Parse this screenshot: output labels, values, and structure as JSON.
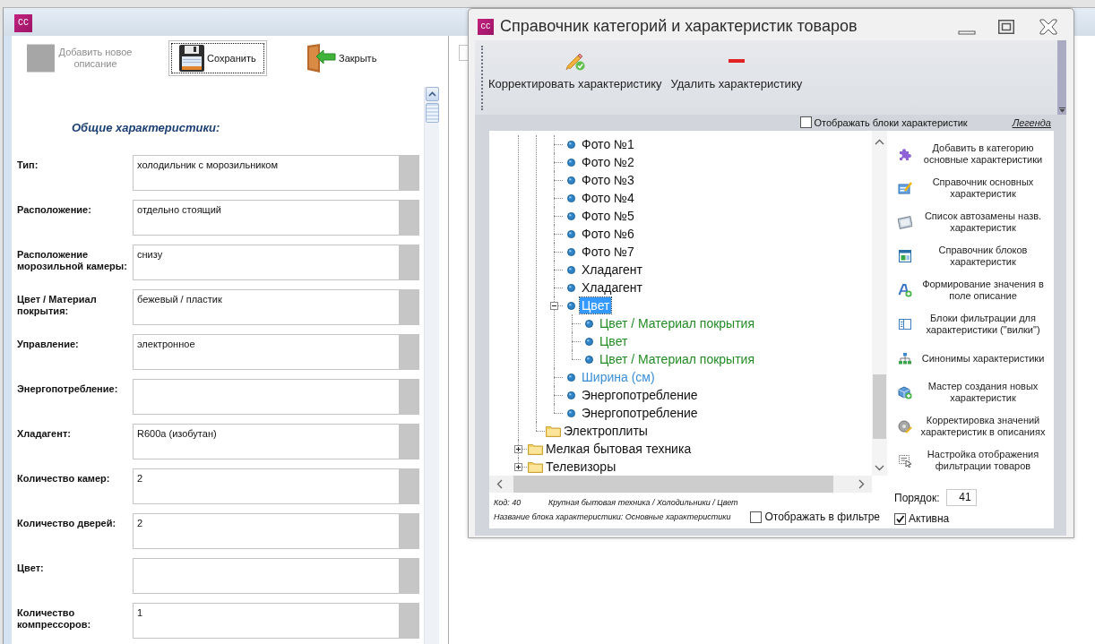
{
  "main_window": {
    "logo": "CC",
    "toolbar": [
      {
        "kind": "add",
        "label": "Добавить новое описание",
        "disabled": true,
        "focused": false
      },
      {
        "kind": "save",
        "label": "Сохранить",
        "disabled": false,
        "focused": true
      },
      {
        "kind": "close",
        "label": "Закрыть",
        "disabled": false,
        "focused": false
      }
    ],
    "section_title": "Общие характеристики:",
    "fields": [
      {
        "label": "Тип:",
        "value": "холодильник с морозильником"
      },
      {
        "label": "Расположение:",
        "value": "отдельно стоящий"
      },
      {
        "label": "Расположение морозильной камеры:",
        "value": "снизу"
      },
      {
        "label": "Цвет / Материал покрытия:",
        "value": "бежевый / пластик"
      },
      {
        "label": "Управление:",
        "value": "электронное"
      },
      {
        "label": "Энергопотребление:"
      },
      {
        "label": "Хладагент:",
        "value": "R600a (изобутан)"
      },
      {
        "label": "Количество камер:",
        "value": "2"
      },
      {
        "label": "Количество дверей:",
        "value": "2"
      },
      {
        "label": "Цвет:"
      },
      {
        "label": "Количество компрессоров:",
        "value": "1"
      }
    ]
  },
  "dialog": {
    "logo": "CC",
    "title": "Справочник категорий и характеристик товаров",
    "toolbar": [
      {
        "kind": "edit",
        "label": "Корректировать характеристику"
      },
      {
        "kind": "delete",
        "label": "Удалить характеристику"
      }
    ],
    "show_blocks": {
      "label": "Отображать блоки характеристик",
      "checked": false
    },
    "legend_link": "Легенда",
    "tree": [
      {
        "children": [
          {
            "children": [
              {
                "kind": "item",
                "label": "Фото №1",
                "selected": false
              },
              {
                "kind": "item",
                "label": "Фото №2",
                "selected": false
              },
              {
                "kind": "item",
                "label": "Фото №3",
                "selected": false
              },
              {
                "kind": "item",
                "label": "Фото №4",
                "selected": false
              },
              {
                "kind": "item",
                "label": "Фото №5",
                "selected": false
              },
              {
                "kind": "item",
                "label": "Фото №6",
                "selected": false
              },
              {
                "kind": "item",
                "label": "Фото №7",
                "selected": false
              },
              {
                "kind": "item",
                "label": "Хладагент",
                "selected": false
              },
              {
                "kind": "item",
                "label": "Хладагент",
                "selected": false
              },
              {
                "kind": "item",
                "label": "Цвет",
                "selected": true,
                "expanded": true,
                "children": [
                  {
                    "kind": "item",
                    "label": "Цвет / Материал покрытия",
                    "selected": false,
                    "color": "#238b23"
                  },
                  {
                    "kind": "item",
                    "label": "Цвет",
                    "selected": false,
                    "color": "#238b23"
                  },
                  {
                    "kind": "item",
                    "label": "Цвет / Материал покрытия",
                    "selected": false,
                    "color": "#238b23"
                  }
                ]
              },
              {
                "kind": "item",
                "label": "Ширина (см)",
                "selected": false,
                "color": "#3b8ed8"
              },
              {
                "kind": "item",
                "label": "Энергопотребление",
                "selected": false
              },
              {
                "kind": "item",
                "label": "Энергопотребление",
                "selected": false
              }
            ]
          },
          {
            "kind": "folder",
            "label": "Электроплиты",
            "selected": false
          }
        ]
      },
      {
        "kind": "folder",
        "label": "Мелкая бытовая техника",
        "selected": false,
        "expanded": false
      },
      {
        "kind": "folder",
        "label": "Телевизоры",
        "selected": false,
        "expanded": false
      }
    ],
    "status": {
      "code": "Код: 40",
      "path": "Крупная бытовая техника / Холодильники / Цвет",
      "block_name": "Название блока характеристики: Основные характеристики"
    },
    "show_in_filter": {
      "label": "Отображать в фильтре",
      "checked": false
    },
    "actions": [
      {
        "kind": "puzzle",
        "label": "Добавить в категорию основные характеристики"
      },
      {
        "kind": "card",
        "label": "Справочник основных характеристик"
      },
      {
        "kind": "frame",
        "label": "Список автозамены назв. характеристик"
      },
      {
        "kind": "layout",
        "label": "Справочник блоков характеристик"
      },
      {
        "kind": "font",
        "label": "Формирование значения в поле описание"
      },
      {
        "kind": "columns",
        "label": "Блоки фильтрации для характеристики (\"вилки\")"
      },
      {
        "kind": "hierarchy",
        "label": "Синонимы характеристики"
      },
      {
        "kind": "cube",
        "label": "Мастер создания новых характеристик"
      },
      {
        "kind": "disc",
        "label": "Корректировка значений характеристик в описаниях"
      },
      {
        "kind": "cursor",
        "label": "Настройка отображения фильтрации товаров"
      }
    ],
    "order": {
      "label": "Порядок:",
      "value": "41"
    },
    "active": {
      "label": "Активна",
      "checked": true
    }
  }
}
